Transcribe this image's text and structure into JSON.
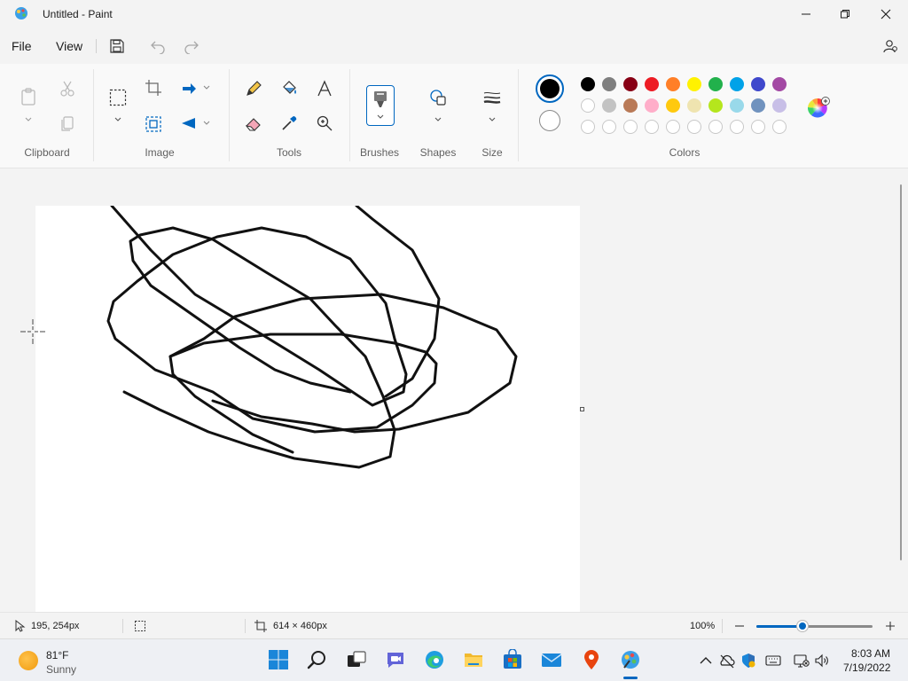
{
  "window": {
    "title": "Untitled - Paint"
  },
  "menu": {
    "file": "File",
    "view": "View"
  },
  "ribbon": {
    "groups": {
      "clipboard": "Clipboard",
      "image": "Image",
      "tools": "Tools",
      "brushes": "Brushes",
      "shapes": "Shapes",
      "size": "Size",
      "colors": "Colors"
    },
    "primary_color": "#000000",
    "secondary_color": "#ffffff",
    "palette_row1": [
      "#000000",
      "#7f7f7f",
      "#880015",
      "#ed1c24",
      "#ff7f27",
      "#fff200",
      "#22b14c",
      "#00a2e8",
      "#3f48cc",
      "#a349a4"
    ],
    "palette_row2": [
      "#ffffff",
      "#c3c3c3",
      "#b97a57",
      "#ffaec9",
      "#ffc90e",
      "#efe4b0",
      "#b5e61d",
      "#99d9ea",
      "#7092be",
      "#c8bfe7"
    ],
    "palette_row3": [
      "#ffffff",
      "#ffffff",
      "#ffffff",
      "#ffffff",
      "#ffffff",
      "#ffffff",
      "#ffffff",
      "#ffffff",
      "#ffffff",
      "#ffffff"
    ]
  },
  "status": {
    "cursor_pos": "195, 254px",
    "canvas_size": "614 × 460px",
    "zoom": "100%",
    "zoom_level": 0.4
  },
  "taskbar": {
    "weather_temp": "81°F",
    "weather_desc": "Sunny",
    "time": "8:03 AM",
    "date": "7/19/2022"
  }
}
